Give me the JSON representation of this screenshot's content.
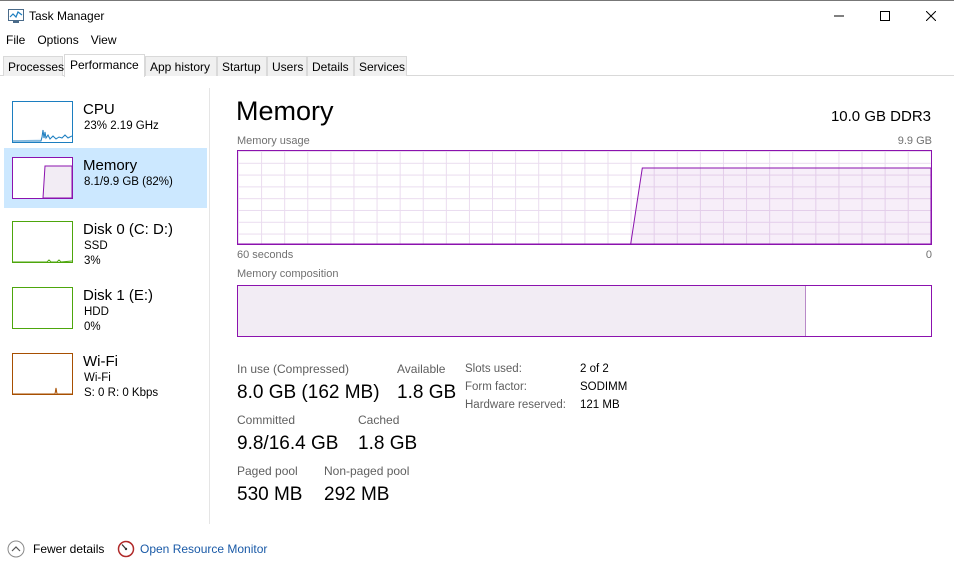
{
  "window": {
    "title": "Task Manager",
    "icon": "task-manager-icon"
  },
  "menu": [
    "File",
    "Options",
    "View"
  ],
  "tabs": [
    "Processes",
    "Performance",
    "App history",
    "Startup",
    "Users",
    "Details",
    "Services"
  ],
  "active_tab": "Performance",
  "sidebar": [
    {
      "name": "CPU",
      "line1": "23%  2.19 GHz",
      "line2": "",
      "line3": "",
      "color": "#1c7ec0",
      "selected": false
    },
    {
      "name": "Memory",
      "line1": "8.1/9.9 GB (82%)",
      "line2": "",
      "line3": "",
      "color": "#8b12ae",
      "selected": true
    },
    {
      "name": "Disk 0 (C: D:)",
      "line1": "SSD",
      "line2": "3%",
      "line3": "",
      "color": "#4da60c",
      "selected": false
    },
    {
      "name": "Disk 1 (E:)",
      "line1": "HDD",
      "line2": "0%",
      "line3": "",
      "color": "#4da60c",
      "selected": false
    },
    {
      "name": "Wi-Fi",
      "line1": "Wi-Fi",
      "line2": "S: 0  R: 0 Kbps",
      "line3": "",
      "color": "#a74f01",
      "selected": false
    }
  ],
  "main": {
    "title": "Memory",
    "spec": "10.0 GB DDR3",
    "usage_label": "Memory usage",
    "usage_max": "9.9 GB",
    "time_label": "60 seconds",
    "time_min": "0",
    "composition_label": "Memory composition",
    "usage_history_fraction": [
      0,
      0,
      0,
      0,
      0,
      0,
      0,
      0,
      0,
      0,
      0,
      0,
      0,
      0,
      0,
      0,
      0,
      0,
      0,
      0,
      0,
      0,
      0,
      0,
      0,
      0,
      0,
      0,
      0,
      0,
      0,
      0,
      0,
      0,
      0,
      0.82,
      0.82,
      0.82,
      0.82,
      0.82,
      0.82,
      0.82,
      0.82,
      0.82,
      0.82,
      0.82,
      0.82,
      0.82,
      0.82,
      0.82,
      0.82,
      0.82,
      0.82,
      0.82,
      0.82,
      0.82,
      0.82,
      0.82,
      0.82,
      0.82,
      0.82
    ],
    "composition_in_use_fraction": 0.82,
    "stats": {
      "in_use_label": "In use (Compressed)",
      "in_use_value": "8.0 GB (162 MB)",
      "available_label": "Available",
      "available_value": "1.8 GB",
      "committed_label": "Committed",
      "committed_value": "9.8/16.4 GB",
      "cached_label": "Cached",
      "cached_value": "1.8 GB",
      "paged_label": "Paged pool",
      "paged_value": "530 MB",
      "nonpaged_label": "Non-paged pool",
      "nonpaged_value": "292 MB"
    },
    "details": {
      "slots_label": "Slots used:",
      "slots_value": "2 of 2",
      "form_label": "Form factor:",
      "form_value": "SODIMM",
      "reserved_label": "Hardware reserved:",
      "reserved_value": "121 MB"
    }
  },
  "footer": {
    "fewer_details": "Fewer details",
    "open_monitor": "Open Resource Monitor"
  },
  "colors": {
    "memory": "#8b12ae",
    "selected_bg": "#cce8ff",
    "link": "#1a5aa7"
  }
}
